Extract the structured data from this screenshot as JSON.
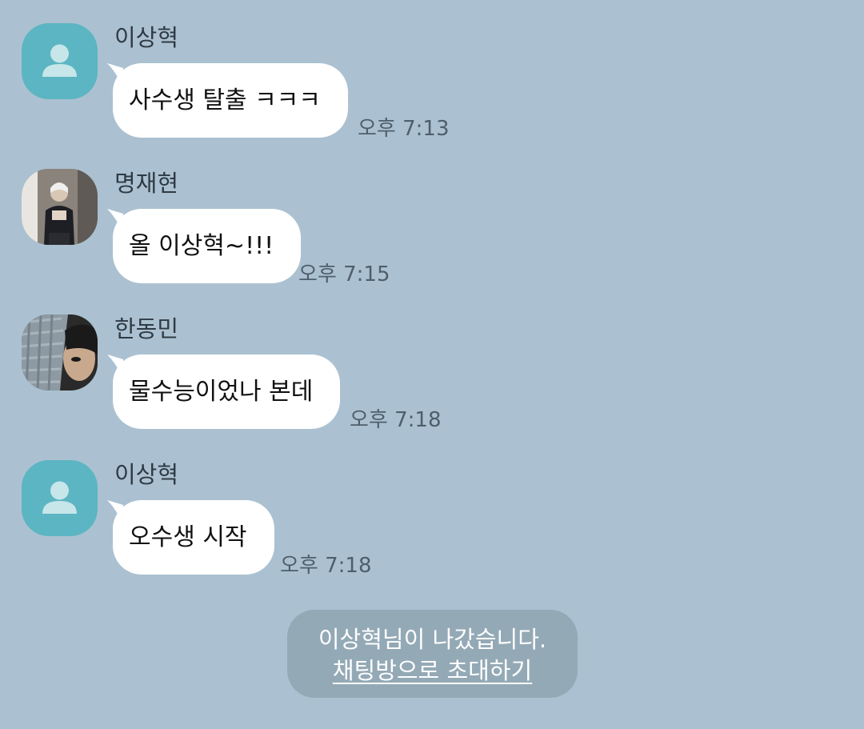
{
  "messages": [
    {
      "sender": "이상혁",
      "text": "사수생 탈출 ㅋㅋㅋ",
      "time": "오후 7:13",
      "avatar": "default-person-icon"
    },
    {
      "sender": "명재현",
      "text": "올 이상혁~!!!",
      "time": "오후 7:15",
      "avatar": "profile-photo"
    },
    {
      "sender": "한동민",
      "text": "물수능이었나 본데",
      "time": "오후 7:18",
      "avatar": "profile-photo"
    },
    {
      "sender": "이상혁",
      "text": "오수생 시작",
      "time": "오후 7:18",
      "avatar": "default-person-icon"
    }
  ],
  "notice": {
    "text": "이상혁님이 나갔습니다.",
    "link": "채팅방으로 초대하기"
  },
  "colors": {
    "background": "#abc1d1",
    "bubble": "#ffffff",
    "default_avatar": "#5cb5c2",
    "notice_bg": "#94a9b6"
  }
}
